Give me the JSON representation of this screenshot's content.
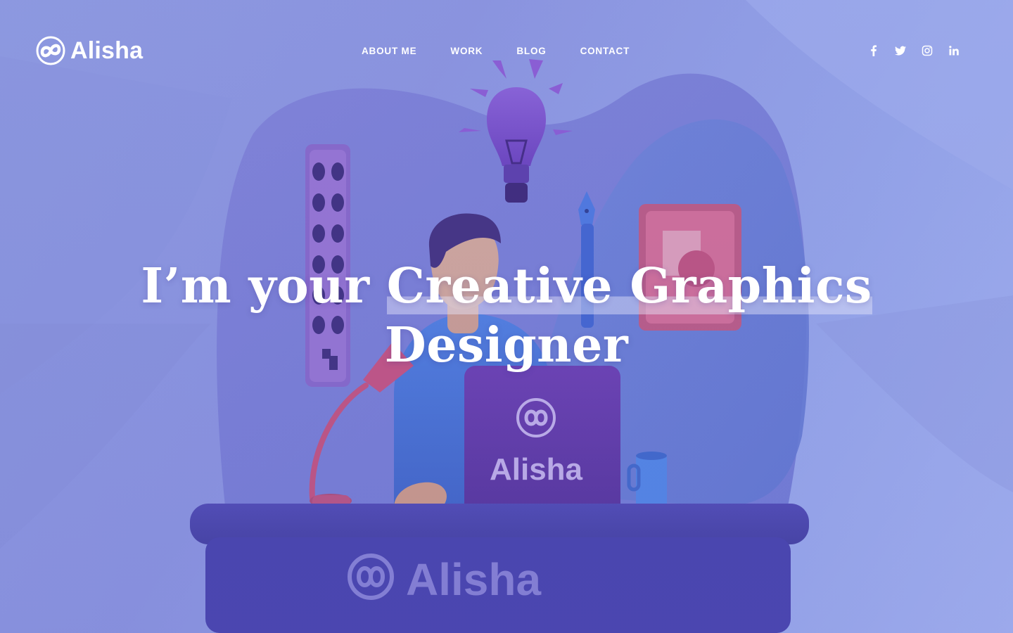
{
  "brand": {
    "name": "Alisha",
    "logo_icon": "infinity-circle-logo"
  },
  "nav": {
    "items": [
      {
        "label": "ABOUT ME"
      },
      {
        "label": "WORK"
      },
      {
        "label": "BLOG"
      },
      {
        "label": "CONTACT"
      }
    ]
  },
  "social": {
    "items": [
      {
        "icon": "facebook-icon"
      },
      {
        "icon": "twitter-icon"
      },
      {
        "icon": "instagram-icon"
      },
      {
        "icon": "linkedin-icon"
      }
    ]
  },
  "hero": {
    "title_lead": "I’m your ",
    "title_highlight": "Creative Graphics",
    "title_tail": "Designer"
  },
  "illustration": {
    "screen_brand": "Alisha",
    "desk_brand": "Alisha"
  },
  "colors": {
    "background": "#8f9be0",
    "text": "#ffffff",
    "accent_purple": "#5a3ea8",
    "accent_pink": "#d15a8a"
  }
}
